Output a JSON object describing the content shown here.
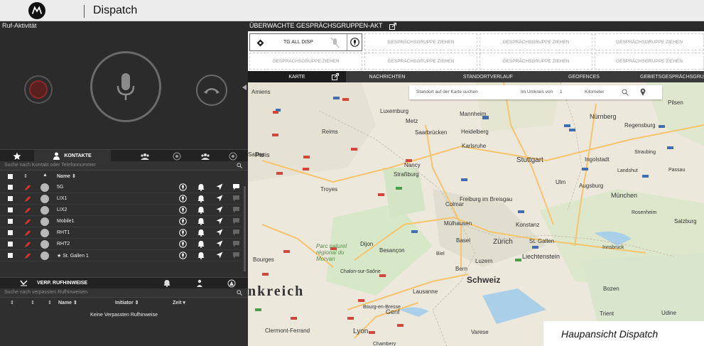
{
  "app": {
    "title": "Dispatch"
  },
  "call": {
    "title": "Ruf-Aktivität"
  },
  "tabs": [
    {
      "label": "",
      "icon": "star-icon"
    },
    {
      "label": "KONTAKTE",
      "icon": "person-icon"
    },
    {
      "label": "",
      "icon": "group-icon"
    },
    {
      "label": "",
      "icon": "radio-group-icon"
    },
    {
      "label": "",
      "icon": "group-icon"
    },
    {
      "label": "",
      "icon": "radio-group-icon"
    }
  ],
  "contacts": {
    "search_placeholder": "Suche nach Kontakt oder Telefonnummer",
    "name_header": "Name ⇕",
    "rows": [
      {
        "name": "5G"
      },
      {
        "name": "LIX1"
      },
      {
        "name": "LIX2"
      },
      {
        "name": "Mobile1"
      },
      {
        "name": "RHT1"
      },
      {
        "name": "RHT2"
      },
      {
        "name": "★ St. Gallen 1"
      }
    ]
  },
  "missed": {
    "tab_label": "VERP. RUFHINWEISE",
    "search_placeholder": "Suche nach verpassten Rufhinweisen",
    "col_name": "Name ⇕",
    "col_initiator": "Initiator ⇕",
    "col_time": "Zeit ▾",
    "empty_text": "Keine Verpassten Rufhinweise"
  },
  "monitored": {
    "title": "ÜBERWACHTE GESPRÄCHSGRUPPEN-AKT",
    "active_group": "TG ALL DISP",
    "drag_label": "GESPRÄCHSGRUPPE ZIEHEN"
  },
  "map_tabs": [
    {
      "label": "KARTE",
      "active": true
    },
    {
      "label": "NACHRICHTEN"
    },
    {
      "label": "STANDORTVERLAUF"
    },
    {
      "label": "GEOFENCES"
    },
    {
      "label": "GEBIETSGESPRÄCHSGRU"
    }
  ],
  "map_search": {
    "placeholder": "Standort auf der Karte suchen",
    "radius_label": "Im Umkreis von",
    "radius_value": "1",
    "unit": "Kilometer"
  },
  "map_places": [
    {
      "name": "Amiens"
    },
    {
      "name": "Luxemburg"
    },
    {
      "name": "Mannheim"
    },
    {
      "name": "Nürnberg"
    },
    {
      "name": "Pilsen"
    },
    {
      "name": "Reims"
    },
    {
      "name": "Saarbrücken"
    },
    {
      "name": "Heidelberg"
    },
    {
      "name": "Metz"
    },
    {
      "name": "Karlsruhe"
    },
    {
      "name": "Regensburg"
    },
    {
      "name": "Straubing"
    },
    {
      "name": "Ingolstadt"
    },
    {
      "name": "Paris"
    },
    {
      "name": "Nancy"
    },
    {
      "name": "Stuttgart"
    },
    {
      "name": "Landshut"
    },
    {
      "name": "Passau"
    },
    {
      "name": "Straßburg"
    },
    {
      "name": "Ulm"
    },
    {
      "name": "Augsburg"
    },
    {
      "name": "Troyes"
    },
    {
      "name": "München"
    },
    {
      "name": "Freiburg im Breisgau"
    },
    {
      "name": "Colmar"
    },
    {
      "name": "Rosenheim"
    },
    {
      "name": "Salzburg"
    },
    {
      "name": "Mülhausen"
    },
    {
      "name": "Konstanz"
    },
    {
      "name": "Basel"
    },
    {
      "name": "Zürich"
    },
    {
      "name": "St. Gallen"
    },
    {
      "name": "Parc naturel régional du Morvan"
    },
    {
      "name": "Dijon"
    },
    {
      "name": "Besançon"
    },
    {
      "name": "Innsbruck"
    },
    {
      "name": "Liechtenstein"
    },
    {
      "name": "Bourges"
    },
    {
      "name": "Biel"
    },
    {
      "name": "Luzern"
    },
    {
      "name": "Bern"
    },
    {
      "name": "Schweiz"
    },
    {
      "name": "Chalon-sur-Saône"
    },
    {
      "name": "Lausanne"
    },
    {
      "name": "Bozen"
    },
    {
      "name": "nkreich"
    },
    {
      "name": "Bourg-en-Bresse"
    },
    {
      "name": "Genf"
    },
    {
      "name": "Trient"
    },
    {
      "name": "Udine"
    },
    {
      "name": "Clermont-Ferrand"
    },
    {
      "name": "Lyon"
    },
    {
      "name": "Varese"
    },
    {
      "name": "Chambery"
    },
    {
      "name": "Sailles"
    }
  ],
  "caption": "Haupansicht Dispatch"
}
